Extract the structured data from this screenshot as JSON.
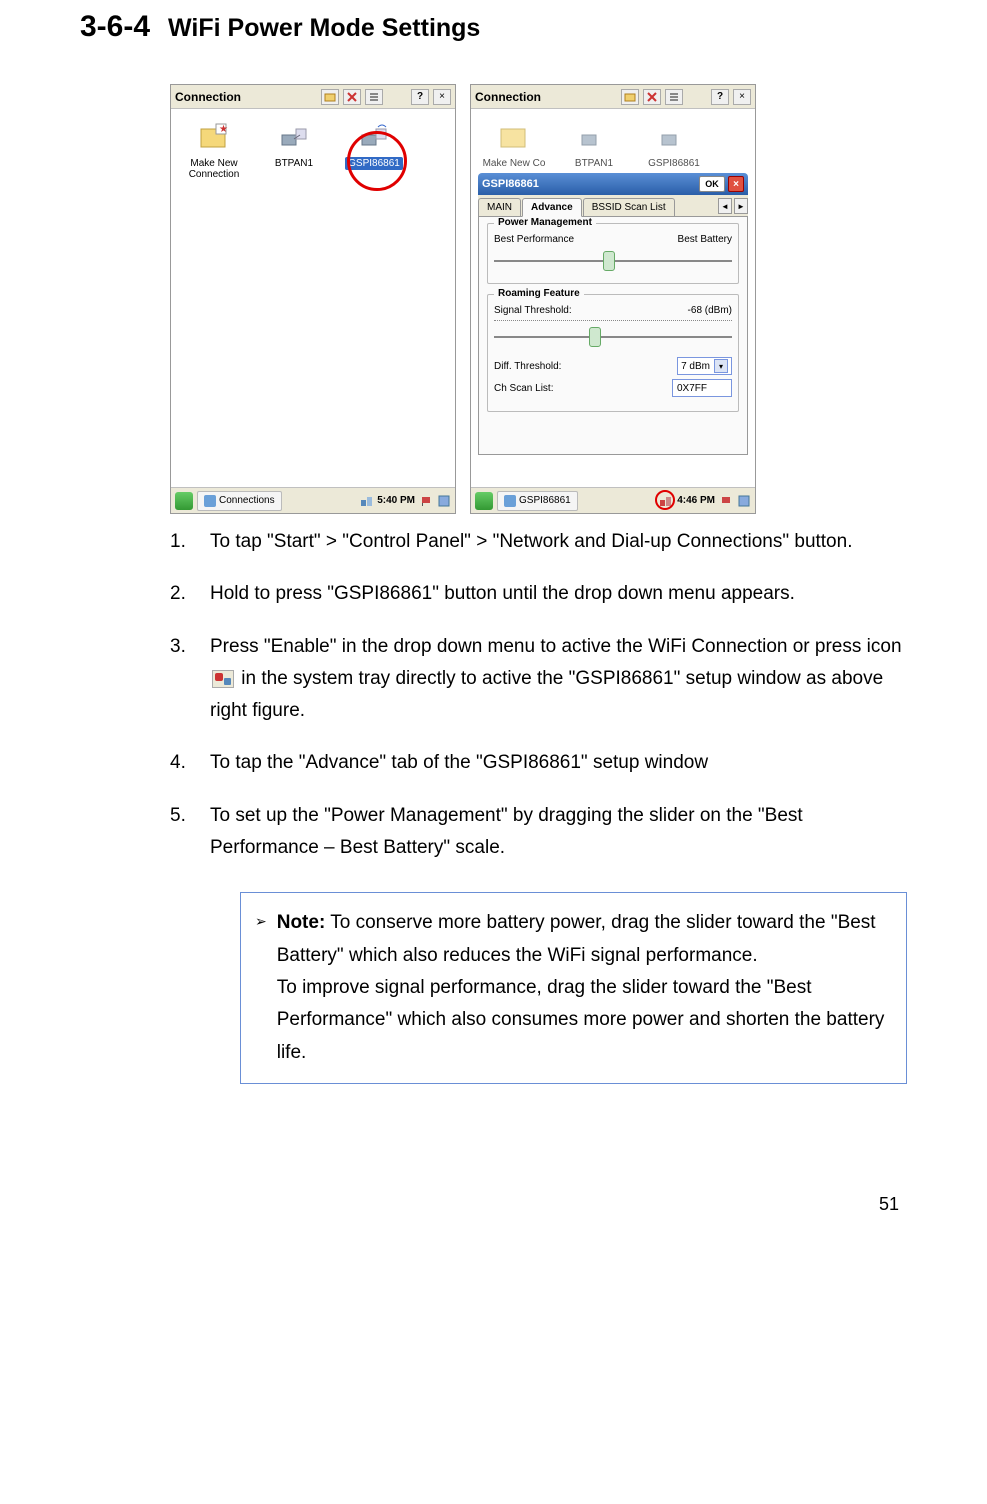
{
  "heading": {
    "number": "3-6-4",
    "title": "WiFi Power Mode Settings"
  },
  "fig_left": {
    "window_title": "Connection",
    "icons": {
      "make_new": "Make New Connection",
      "btpan": "BTPAN1",
      "gspi": "GSPI86861"
    },
    "taskbar_task": "Connections",
    "taskbar_time": "5:40 PM"
  },
  "fig_right": {
    "window_title": "Connection",
    "icons": {
      "make_new": "Make New Co",
      "btpan": "BTPAN1",
      "gspi": "GSPI86861"
    },
    "dialog_title": "GSPI86861",
    "dialog_ok": "OK",
    "tabs": {
      "main": "MAIN",
      "advance": "Advance",
      "bssid": "BSSID Scan List"
    },
    "pm_title": "Power Management",
    "pm_left": "Best Performance",
    "pm_right": "Best Battery",
    "roam_title": "Roaming Feature",
    "roam_signal_label": "Signal Threshold:",
    "roam_signal_value": "-68 (dBm)",
    "roam_diff_label": "Diff. Threshold:",
    "roam_diff_value": "7 dBm",
    "roam_ch_label": "Ch Scan List:",
    "roam_ch_value": "0X7FF",
    "taskbar_task": "GSPI86861",
    "taskbar_time": "4:46 PM"
  },
  "instructions": {
    "i1": {
      "n": "1.",
      "t": "To tap \"Start\" > \"Control Panel\" > \"Network and Dial-up Connections\" button."
    },
    "i2": {
      "n": "2.",
      "t": "Hold to press \"GSPI86861\" button until the drop down menu appears."
    },
    "i3": {
      "n": "3.",
      "t1": "Press \"Enable\" in the drop down menu to active the WiFi Connection or press icon",
      "t2": " in the system tray directly to active the \"GSPI86861\" setup window as above right figure."
    },
    "i4": {
      "n": "4.",
      "t": "To tap the \"Advance\" tab of the \"GSPI86861\" setup window"
    },
    "i5": {
      "n": "5.",
      "t": "To set up the \"Power Management\" by dragging the slider on the \"Best Performance – Best Battery\" scale."
    }
  },
  "note": {
    "bold": "Note:",
    "body1": " To conserve more battery power, drag the slider toward the \"Best Battery\" which also reduces the WiFi signal performance.",
    "body2": "To improve signal performance, drag the slider toward the \"Best Performance\" which also consumes more power and shorten the battery life."
  },
  "page_number": "51"
}
